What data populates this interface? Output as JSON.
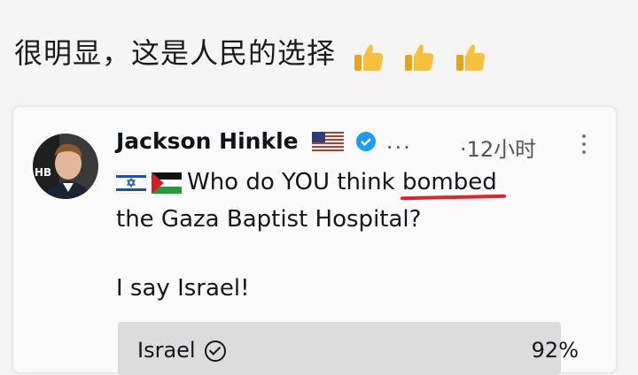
{
  "caption": {
    "text": "很明显，这是人民的选择"
  },
  "tweet": {
    "author": "Jackson Hinkle",
    "more": "...",
    "time": "·12小时",
    "text_line1": "Who do YOU think ",
    "text_highlight": "bombed",
    "text_line2": "the Gaza Baptist Hospital?",
    "opinion": "I say Israel!",
    "avatar_monogram": "HB"
  },
  "poll": {
    "option_label": "Israel",
    "percent": "92%",
    "percent_value": 92
  },
  "icons": {
    "caption_emoji": "thumbs-up-icon",
    "flags": [
      "israel-flag-icon",
      "palestine-flag-icon",
      "usa-flag-icon"
    ],
    "verified": "verified-badge-icon"
  },
  "colors": {
    "highlight_underline": "#e0242e",
    "verified_blue": "#1d9bf0",
    "poll_bar": "#dcdcdc"
  }
}
